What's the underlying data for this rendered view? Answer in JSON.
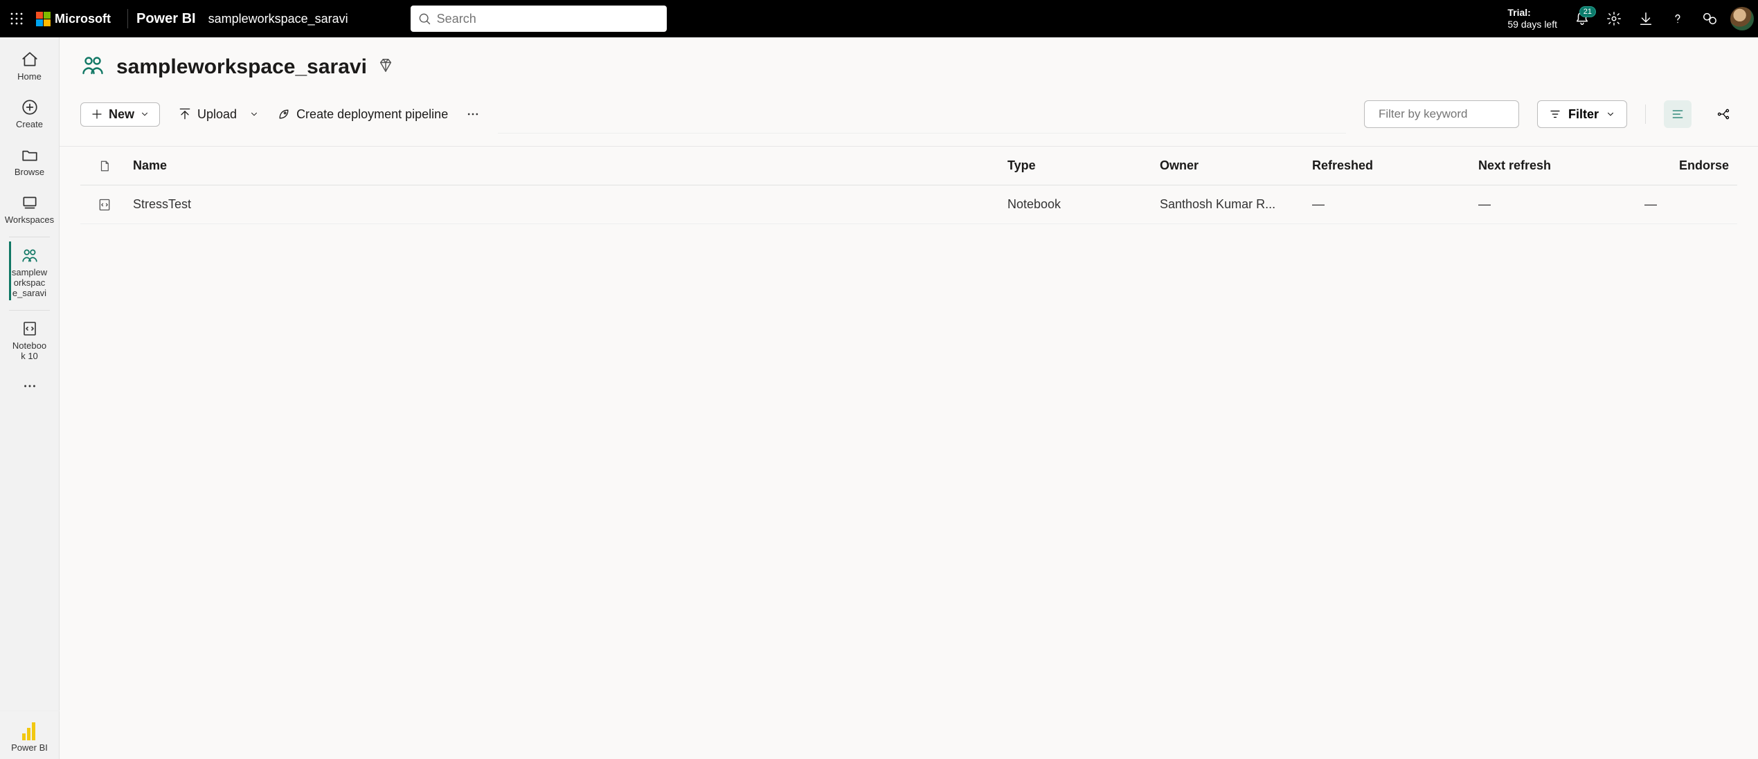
{
  "header": {
    "brand": "Microsoft",
    "app": "Power BI",
    "breadcrumb": "sampleworkspace_saravi",
    "search_placeholder": "Search",
    "trial_line1": "Trial:",
    "trial_line2": "59 days left",
    "notification_count": "21"
  },
  "leftnav": {
    "home": "Home",
    "create": "Create",
    "browse": "Browse",
    "workspaces": "Workspaces",
    "current_ws": "sampleworkspace_saravi",
    "notebook": "Notebook 10",
    "powerbi": "Power BI"
  },
  "workspace": {
    "title": "sampleworkspace_saravi"
  },
  "toolbar": {
    "new": "New",
    "upload": "Upload",
    "pipeline": "Create deployment pipeline",
    "filter_placeholder": "Filter by keyword",
    "filter": "Filter"
  },
  "columns": {
    "name": "Name",
    "type": "Type",
    "owner": "Owner",
    "refreshed": "Refreshed",
    "next": "Next refresh",
    "endorse": "Endorse"
  },
  "rows": [
    {
      "name": "StressTest",
      "type": "Notebook",
      "owner": "Santhosh Kumar R...",
      "refreshed": "—",
      "next": "—",
      "endorse": "—"
    }
  ]
}
